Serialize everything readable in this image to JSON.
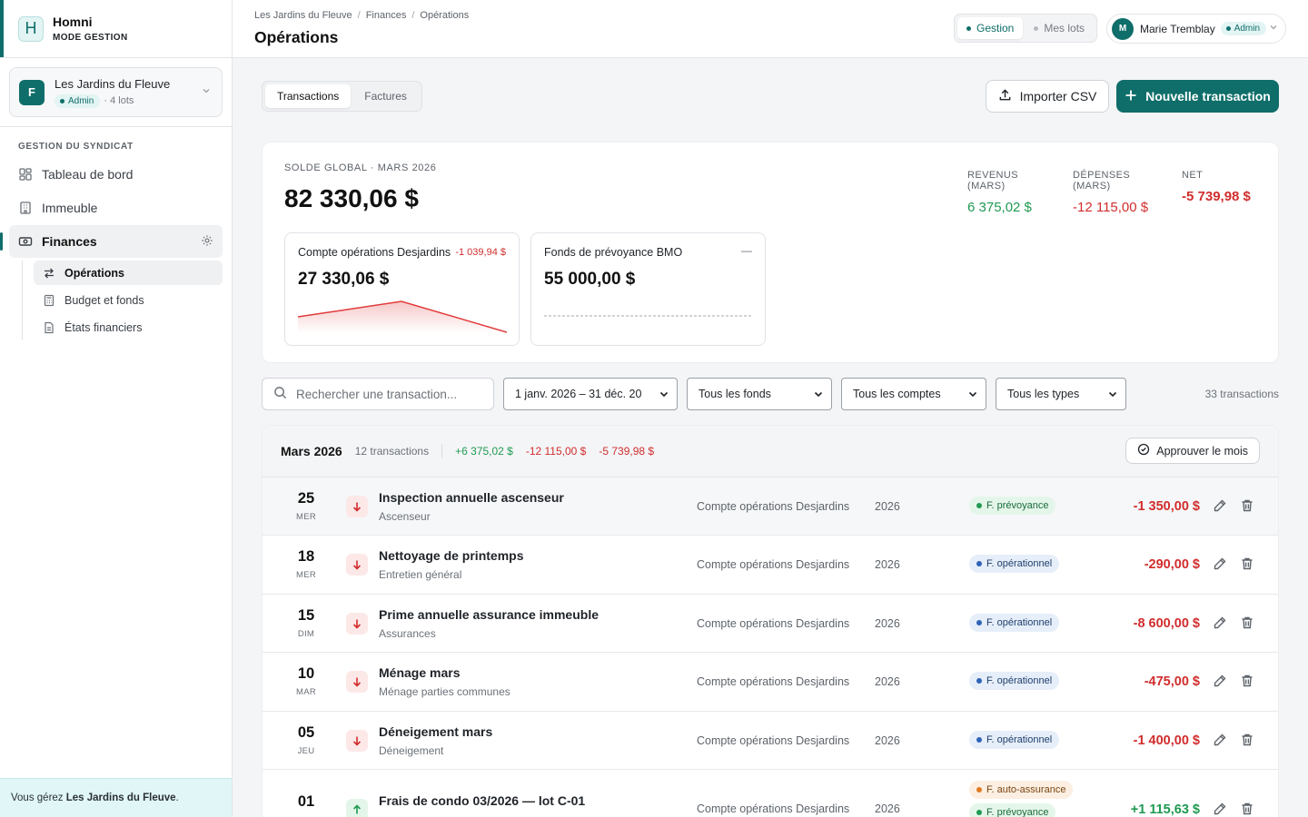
{
  "app": {
    "name": "Homni",
    "mode": "MODE GESTION",
    "logo_letter": "H",
    "accent": "#0f6e6a"
  },
  "org": {
    "avatar": "F",
    "name": "Les Jardins du Fleuve",
    "role": "Admin",
    "lots": "· 4 lots"
  },
  "sidebar": {
    "section": "GESTION DU SYNDICAT",
    "items": [
      {
        "label": "Tableau de bord",
        "icon": "grid-icon"
      },
      {
        "label": "Immeuble",
        "icon": "building-icon"
      },
      {
        "label": "Finances",
        "icon": "cash-icon",
        "active": true
      }
    ],
    "sub_items": [
      {
        "label": "Opérations",
        "icon": "arrows-swap-icon",
        "active": true
      },
      {
        "label": "Budget et fonds",
        "icon": "calculator-icon"
      },
      {
        "label": "États financiers",
        "icon": "document-icon"
      }
    ],
    "footer_prefix": "Vous gérez ",
    "footer_org": "Les Jardins du Fleuve",
    "footer_suffix": "."
  },
  "topbar": {
    "breadcrumb": [
      "Les Jardins du Fleuve",
      "Finances",
      "Opérations"
    ],
    "breadcrumb_sep": "/",
    "title": "Opérations",
    "modes": [
      "Gestion",
      "Mes lots"
    ],
    "user": {
      "initial": "M",
      "name": "Marie Tremblay",
      "role": "Admin"
    }
  },
  "toolbar": {
    "tabs": [
      "Transactions",
      "Factures"
    ],
    "import_label": "Importer CSV",
    "new_label": "Nouvelle transaction"
  },
  "summary": {
    "label": "SOLDE GLOBAL · MARS 2026",
    "total": "82 330,06 $",
    "kpis": [
      {
        "label": "REVENUS (MARS)",
        "value": "6 375,02 $",
        "tone": "green"
      },
      {
        "label": "DÉPENSES (MARS)",
        "value": "-12 115,00 $",
        "tone": "red"
      },
      {
        "label": "NET",
        "value": "-5 739,98 $",
        "tone": "red",
        "bold": true
      }
    ],
    "accounts": [
      {
        "name": "Compte opérations Desjardins",
        "delta": "-1 039,94 $",
        "value": "27 330,06 $",
        "trend": "down"
      },
      {
        "name": "Fonds de prévoyance BMO",
        "delta": "—",
        "value": "55 000,00 $",
        "trend": "flat"
      }
    ]
  },
  "filters": {
    "search_placeholder": "Rechercher une transaction...",
    "date_range": "1 janv. 2026 – 31 déc. 20",
    "fund": "Tous les fonds",
    "account": "Tous les comptes",
    "type": "Tous les types",
    "count": "33 transactions"
  },
  "month": {
    "title": "Mars 2026",
    "count": "12 transactions",
    "revenue": "+6 375,02 $",
    "expense": "-12 115,00 $",
    "net": "-5 739,98 $",
    "approve_label": "Approuver le mois"
  },
  "transactions": [
    {
      "day": "25",
      "dow": "MER",
      "title": "Inspection annuelle ascenseur",
      "category": "Ascenseur",
      "account": "Compte opérations Desjardins",
      "year": "2026",
      "funds": [
        {
          "label": "F. prévoyance",
          "kind": "prev"
        }
      ],
      "amount": "-1 350,00 $",
      "direction": "out"
    },
    {
      "day": "18",
      "dow": "MER",
      "title": "Nettoyage de printemps",
      "category": "Entretien général",
      "account": "Compte opérations Desjardins",
      "year": "2026",
      "funds": [
        {
          "label": "F. opérationnel",
          "kind": "op"
        }
      ],
      "amount": "-290,00 $",
      "direction": "out"
    },
    {
      "day": "15",
      "dow": "DIM",
      "title": "Prime annuelle assurance immeuble",
      "category": "Assurances",
      "account": "Compte opérations Desjardins",
      "year": "2026",
      "funds": [
        {
          "label": "F. opérationnel",
          "kind": "op"
        }
      ],
      "amount": "-8 600,00 $",
      "direction": "out"
    },
    {
      "day": "10",
      "dow": "MAR",
      "title": "Ménage mars",
      "category": "Ménage parties communes",
      "account": "Compte opérations Desjardins",
      "year": "2026",
      "funds": [
        {
          "label": "F. opérationnel",
          "kind": "op"
        }
      ],
      "amount": "-475,00 $",
      "direction": "out"
    },
    {
      "day": "05",
      "dow": "JEU",
      "title": "Déneigement mars",
      "category": "Déneigement",
      "account": "Compte opérations Desjardins",
      "year": "2026",
      "funds": [
        {
          "label": "F. opérationnel",
          "kind": "op"
        }
      ],
      "amount": "-1 400,00 $",
      "direction": "out"
    },
    {
      "day": "01",
      "dow": "",
      "title": "Frais de condo 03/2026 — lot C-01",
      "category": "",
      "account": "Compte opérations Desjardins",
      "year": "2026",
      "funds": [
        {
          "label": "F. auto-assurance",
          "kind": "auto"
        },
        {
          "label": "F. prévoyance",
          "kind": "prev"
        }
      ],
      "amount": "+1 115,63 $",
      "direction": "in"
    }
  ],
  "colors": {
    "positive": "#1f9a52",
    "negative": "#d12d2d",
    "brand": "#0f6e6a"
  }
}
